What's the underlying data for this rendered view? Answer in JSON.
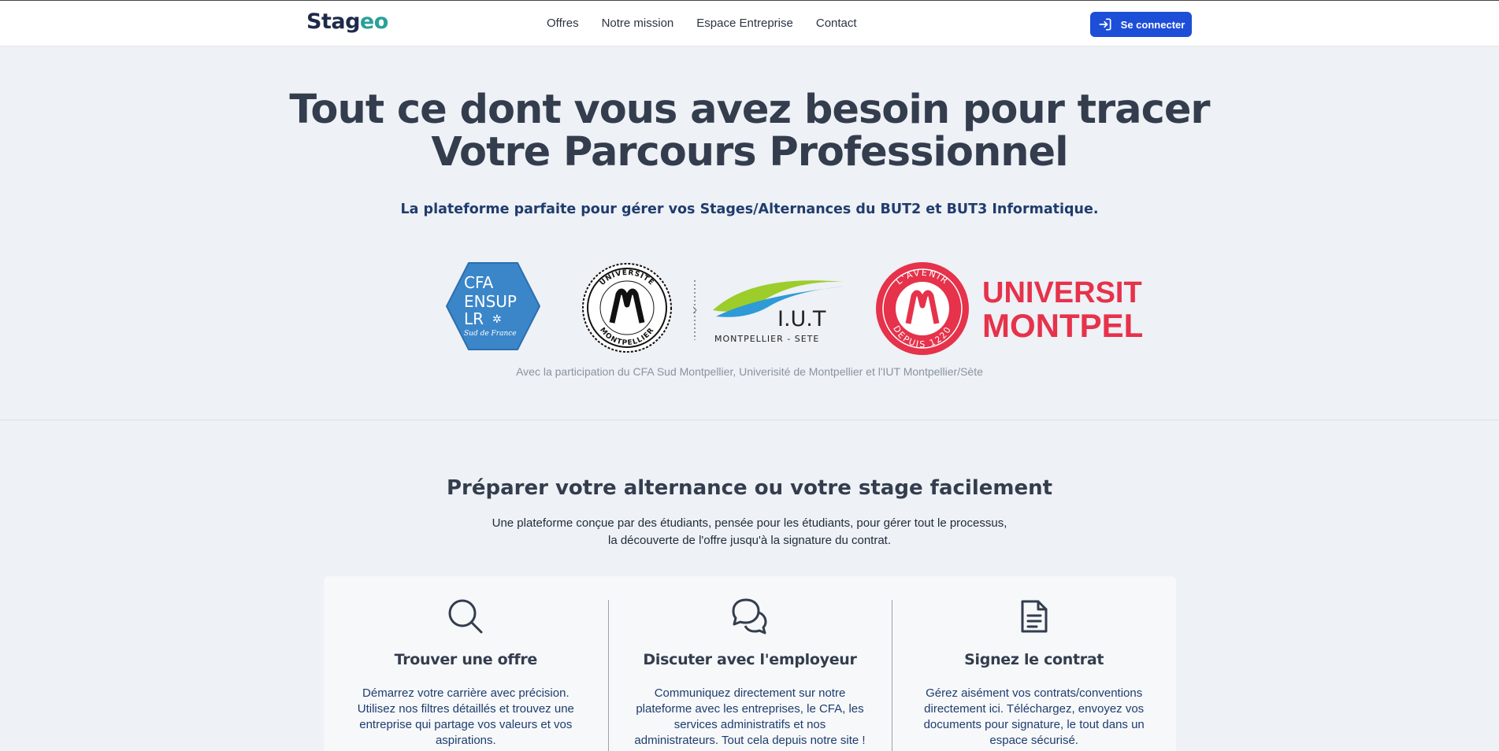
{
  "nav": {
    "brand_part1": "Stag",
    "brand_part2": "eo",
    "links": [
      "Offres",
      "Notre mission",
      "Espace Entreprise",
      "Contact"
    ],
    "login_label": "Se connecter"
  },
  "hero": {
    "title_line1": "Tout ce dont vous avez besoin pour tracer",
    "title_line2": "Votre Parcours Professionnel",
    "subtitle": "La plateforme parfaite pour gérer vos Stages/Alternances du BUT2 et BUT3 Informatique.",
    "partners_caption": "Avec la participation du CFA Sud Montpellier, Univerisité de Montpellier et l'IUT Montpellier/Sète"
  },
  "logos": {
    "cfa": {
      "line1": "CFA",
      "line2": "ENSUP",
      "line3": "LR",
      "line4": "Sud de France"
    },
    "univ_seal": {
      "ring_top": "UNIVERSITÉ",
      "ring_bottom": "MONTPELLIER"
    },
    "iut": {
      "name": "I.U.T",
      "place": "MONTPELLIER - SETE"
    },
    "um": {
      "ring_top": "L'AVENIR",
      "ring_bottom": "DEPUIS 1220",
      "line1": "UNIVERSITÉ DE",
      "line2": "MONTPELLIER"
    }
  },
  "features": {
    "title": "Préparer votre alternance ou votre stage facilement",
    "desc_line1": "Une plateforme conçue par des étudiants, pensée pour les étudiants, pour gérer tout le processus,",
    "desc_line2": "la découverte de l'offre jusqu'à la signature du contrat.",
    "cards": [
      {
        "icon": "search-icon",
        "title": "Trouver une offre",
        "text": "Démarrez votre carrière avec précision. Utilisez nos filtres détaillés et trouvez une entreprise qui partage vos valeurs et vos aspirations."
      },
      {
        "icon": "chat-icon",
        "title": "Discuter avec l'employeur",
        "text": "Communiquez directement sur notre plateforme avec les entreprises, le CFA, les services administratifs et nos administrateurs. Tout cela depuis notre site !"
      },
      {
        "icon": "document-icon",
        "title": "Signez le contrat",
        "text": "Gérez aisément vos contrats/conventions directement ici. Téléchargez, envoyez vos documents pour signature, le tout dans un espace sécurisé."
      }
    ]
  },
  "colors": {
    "primary": "#1d4ed8",
    "brand_dark": "#1e2a4a",
    "brand_accent": "#2aa198",
    "um_red": "#e6324b",
    "cfa_blue": "#3b86c9"
  }
}
